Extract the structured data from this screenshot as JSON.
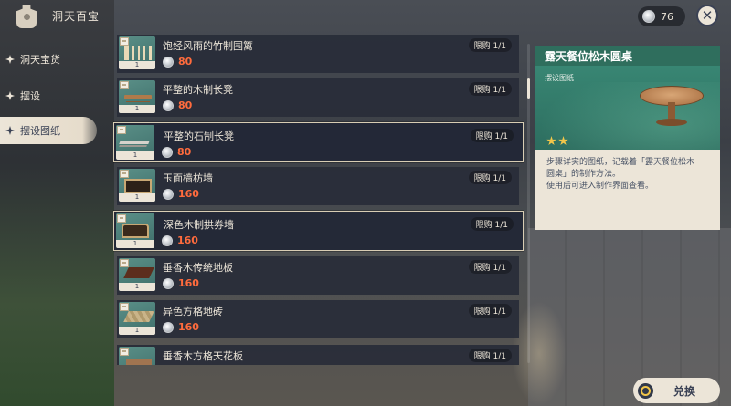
{
  "header": {
    "title": "洞天百宝",
    "currency_amount": "76",
    "close_symbol": "✕"
  },
  "sidebar": {
    "items": [
      {
        "label": "洞天宝货",
        "active": false
      },
      {
        "label": "摆设",
        "active": false
      },
      {
        "label": "摆设图纸",
        "active": true
      }
    ]
  },
  "shop_list": {
    "items": [
      {
        "name": "饱经风雨的竹制围篱",
        "price": "80",
        "limit": "限购 1/1",
        "count": "1",
        "art": "fence",
        "highlight": false
      },
      {
        "name": "平整的木制长凳",
        "price": "80",
        "limit": "限购 1/1",
        "count": "1",
        "art": "bench",
        "highlight": false
      },
      {
        "name": "平整的石制长凳",
        "price": "80",
        "limit": "限购 1/1",
        "count": "1",
        "art": "stone",
        "highlight": true
      },
      {
        "name": "玉面樯枋墙",
        "price": "160",
        "limit": "限购 1/1",
        "count": "1",
        "art": "wall",
        "highlight": false
      },
      {
        "name": "深色木制拱券墙",
        "price": "160",
        "limit": "限购 1/1",
        "count": "1",
        "art": "arch",
        "highlight": true
      },
      {
        "name": "垂香木传统地板",
        "price": "160",
        "limit": "限购 1/1",
        "count": "1",
        "art": "floor1",
        "highlight": false
      },
      {
        "name": "异色方格地砖",
        "price": "160",
        "limit": "限购 1/1",
        "count": "1",
        "art": "floor2",
        "highlight": false
      },
      {
        "name": "垂香木方格天花板",
        "price": "",
        "limit": "限购 1/1",
        "count": "1",
        "art": "floor3",
        "highlight": false
      }
    ]
  },
  "detail": {
    "title": "露天餐位松木圆桌",
    "type_label": "摆设图纸",
    "star_count": 2,
    "description_lines": [
      "步骤详实的图纸，记载着「露天餐位松木",
      "圆桌」的制作方法。",
      "使用后可进入制作界面查看。"
    ]
  },
  "footer": {
    "exchange_label": "兑换"
  },
  "colors": {
    "accent_green": "#3b8c78",
    "price_red": "#ff6b3d",
    "cream": "#ece5d8",
    "star_gold": "#f2c64a"
  },
  "icons": {
    "bag": "bag-icon",
    "coin": "coin-icon",
    "close": "close-icon",
    "menu_star": "four-point-star-icon",
    "rarity_star": "star-icon"
  }
}
